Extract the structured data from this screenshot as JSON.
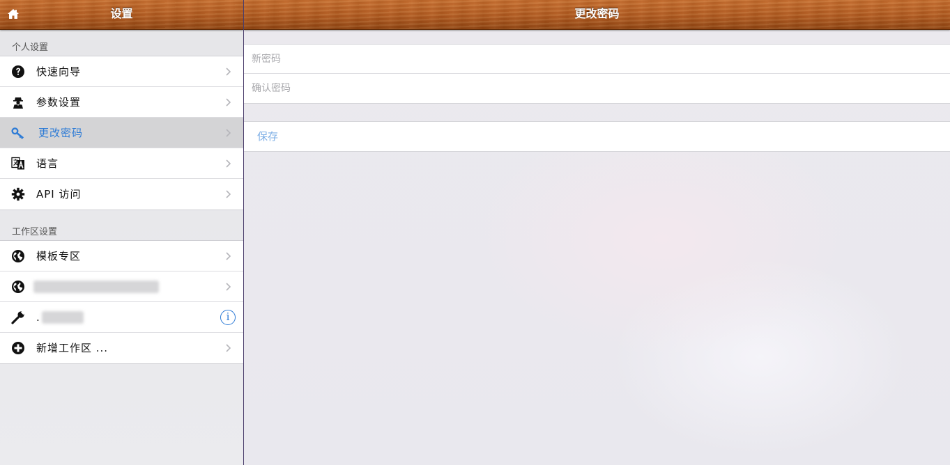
{
  "left_header": {
    "title": "设置",
    "home_icon": "home-icon"
  },
  "right_header": {
    "title": "更改密码"
  },
  "personal_section": {
    "title": "个人设置",
    "items": [
      {
        "label": "快速向导",
        "icon": "question-icon"
      },
      {
        "label": "参数设置",
        "icon": "agent-icon"
      },
      {
        "label": "更改密码",
        "icon": "key-icon",
        "selected": true
      },
      {
        "label": "语言",
        "icon": "translate-icon"
      },
      {
        "label": "API 访问",
        "icon": "gear-icon"
      }
    ]
  },
  "workspace_section": {
    "title": "工作区设置",
    "items": [
      {
        "label": "模板专区",
        "icon": "globe-icon"
      },
      {
        "label": "",
        "icon": "globe-icon",
        "redacted": true
      },
      {
        "label": ".",
        "icon": "wrench-icon",
        "redacted": true,
        "accessory": "i"
      },
      {
        "label": "新增工作区 ...",
        "icon": "plus-circle-icon"
      }
    ]
  },
  "password_form": {
    "new_password_placeholder": "新密码",
    "confirm_password_placeholder": "确认密码",
    "save_label": "保存"
  },
  "colors": {
    "accent": "#2d7bd6",
    "save_text": "#7fb0e6",
    "selected_row": "#d4d4d6",
    "wood": "#b15a1f"
  }
}
